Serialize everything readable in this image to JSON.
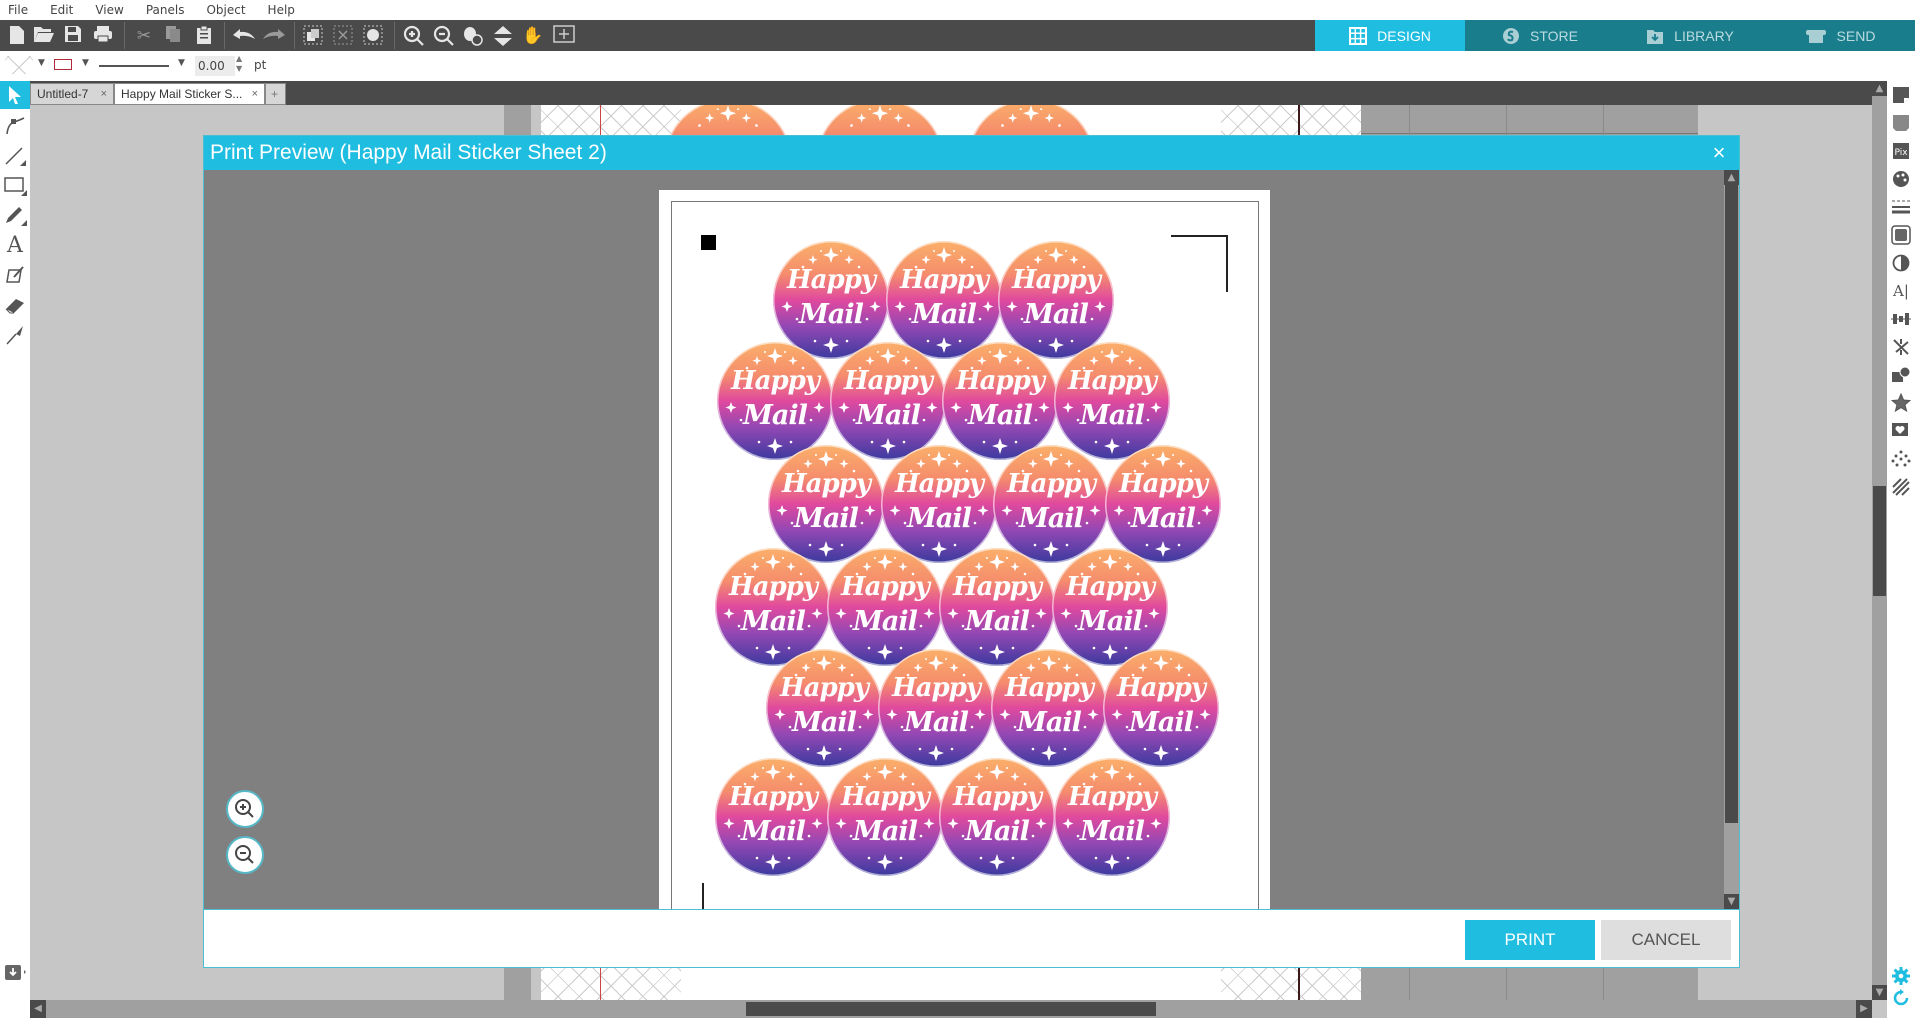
{
  "menu": [
    "File",
    "Edit",
    "View",
    "Panels",
    "Object",
    "Help"
  ],
  "toolbar": {
    "icons": [
      "new-file-icon",
      "open-folder-icon",
      "save-icon",
      "print-icon",
      "cut-icon",
      "copy-icon",
      "paste-icon",
      "undo-icon",
      "redo-icon",
      "group-icon",
      "ungroup-icon",
      "fill-select-icon",
      "zoom-in-icon",
      "zoom-out-icon",
      "zoom-select-icon",
      "move-down-icon",
      "pan-hand-icon",
      "fit-page-icon"
    ]
  },
  "mode_tabs": [
    {
      "label": "DESIGN",
      "icon": "grid-icon",
      "active": true
    },
    {
      "label": "STORE",
      "icon": "store-icon",
      "active": false
    },
    {
      "label": "LIBRARY",
      "icon": "library-icon",
      "active": false
    },
    {
      "label": "SEND",
      "icon": "send-icon",
      "active": false
    }
  ],
  "props": {
    "line_width": "0.00",
    "unit": "pt"
  },
  "doc_tabs": [
    {
      "label": "Untitled-7",
      "active": false
    },
    {
      "label": "Happy Mail Sticker S...",
      "active": true
    }
  ],
  "add_tab": "+",
  "dialog": {
    "title": "Print Preview (Happy Mail Sticker Sheet 2)",
    "close": "×",
    "print_label": "PRINT",
    "cancel_label": "CANCEL"
  },
  "sticker": {
    "line1": "Happy",
    "line2": "Mail"
  },
  "sticker_rows": [
    3,
    4,
    4,
    4,
    4,
    4
  ],
  "colors": {
    "accent": "#1fbde0",
    "toolbar_bg": "#4a4a4a",
    "canvas_bg": "#c6c6c6",
    "preview_bg": "#808080"
  }
}
